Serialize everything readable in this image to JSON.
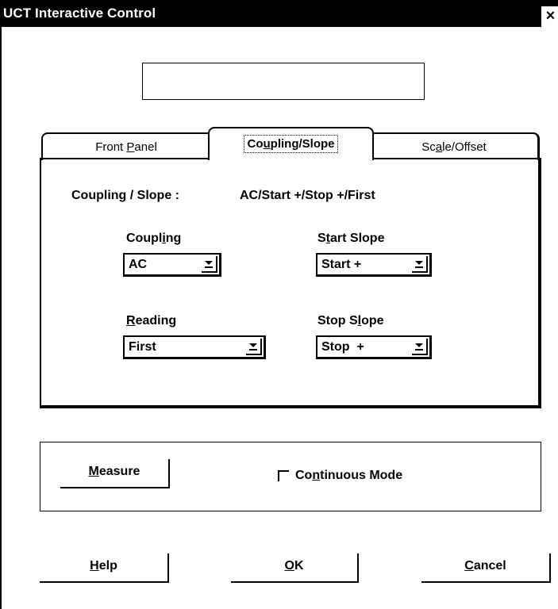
{
  "window": {
    "title": "UCT Interactive Control",
    "close_symbol": "×"
  },
  "display": {
    "value": ""
  },
  "tabs": [
    {
      "label_pre": "Front ",
      "label_u": "P",
      "label_post": "anel",
      "selected": false
    },
    {
      "label_pre": "Co",
      "label_u": "u",
      "label_post": "pling/Slope",
      "selected": true
    },
    {
      "label_pre": "Sc",
      "label_u": "a",
      "label_post": "le/Offset",
      "selected": false
    }
  ],
  "summary": {
    "label": "Coupling / Slope :",
    "value": "AC/Start +/Stop  +/First"
  },
  "fields": {
    "coupling": {
      "label_pre": "Coupl",
      "label_u": "i",
      "label_post": "ng",
      "value": "AC"
    },
    "start_slope": {
      "label_pre": "S",
      "label_u": "t",
      "label_post": "art Slope",
      "value": "Start +"
    },
    "reading": {
      "label_pre": "",
      "label_u": "R",
      "label_post": "eading",
      "value": "First"
    },
    "stop_slope": {
      "label_pre": "Stop S",
      "label_u": "l",
      "label_post": "ope",
      "value": "Stop  +"
    }
  },
  "measure": {
    "label_pre": "",
    "label_u": "M",
    "label_post": "easure"
  },
  "continuous": {
    "label_pre": "Co",
    "label_u": "n",
    "label_post": "tinuous Mode",
    "checked": false
  },
  "buttons": {
    "help": {
      "label_pre": "",
      "label_u": "H",
      "label_post": "elp"
    },
    "ok": {
      "label_pre": "",
      "label_u": "O",
      "label_post": "K"
    },
    "cancel": {
      "label_pre": "",
      "label_u": "C",
      "label_post": "ancel"
    }
  }
}
